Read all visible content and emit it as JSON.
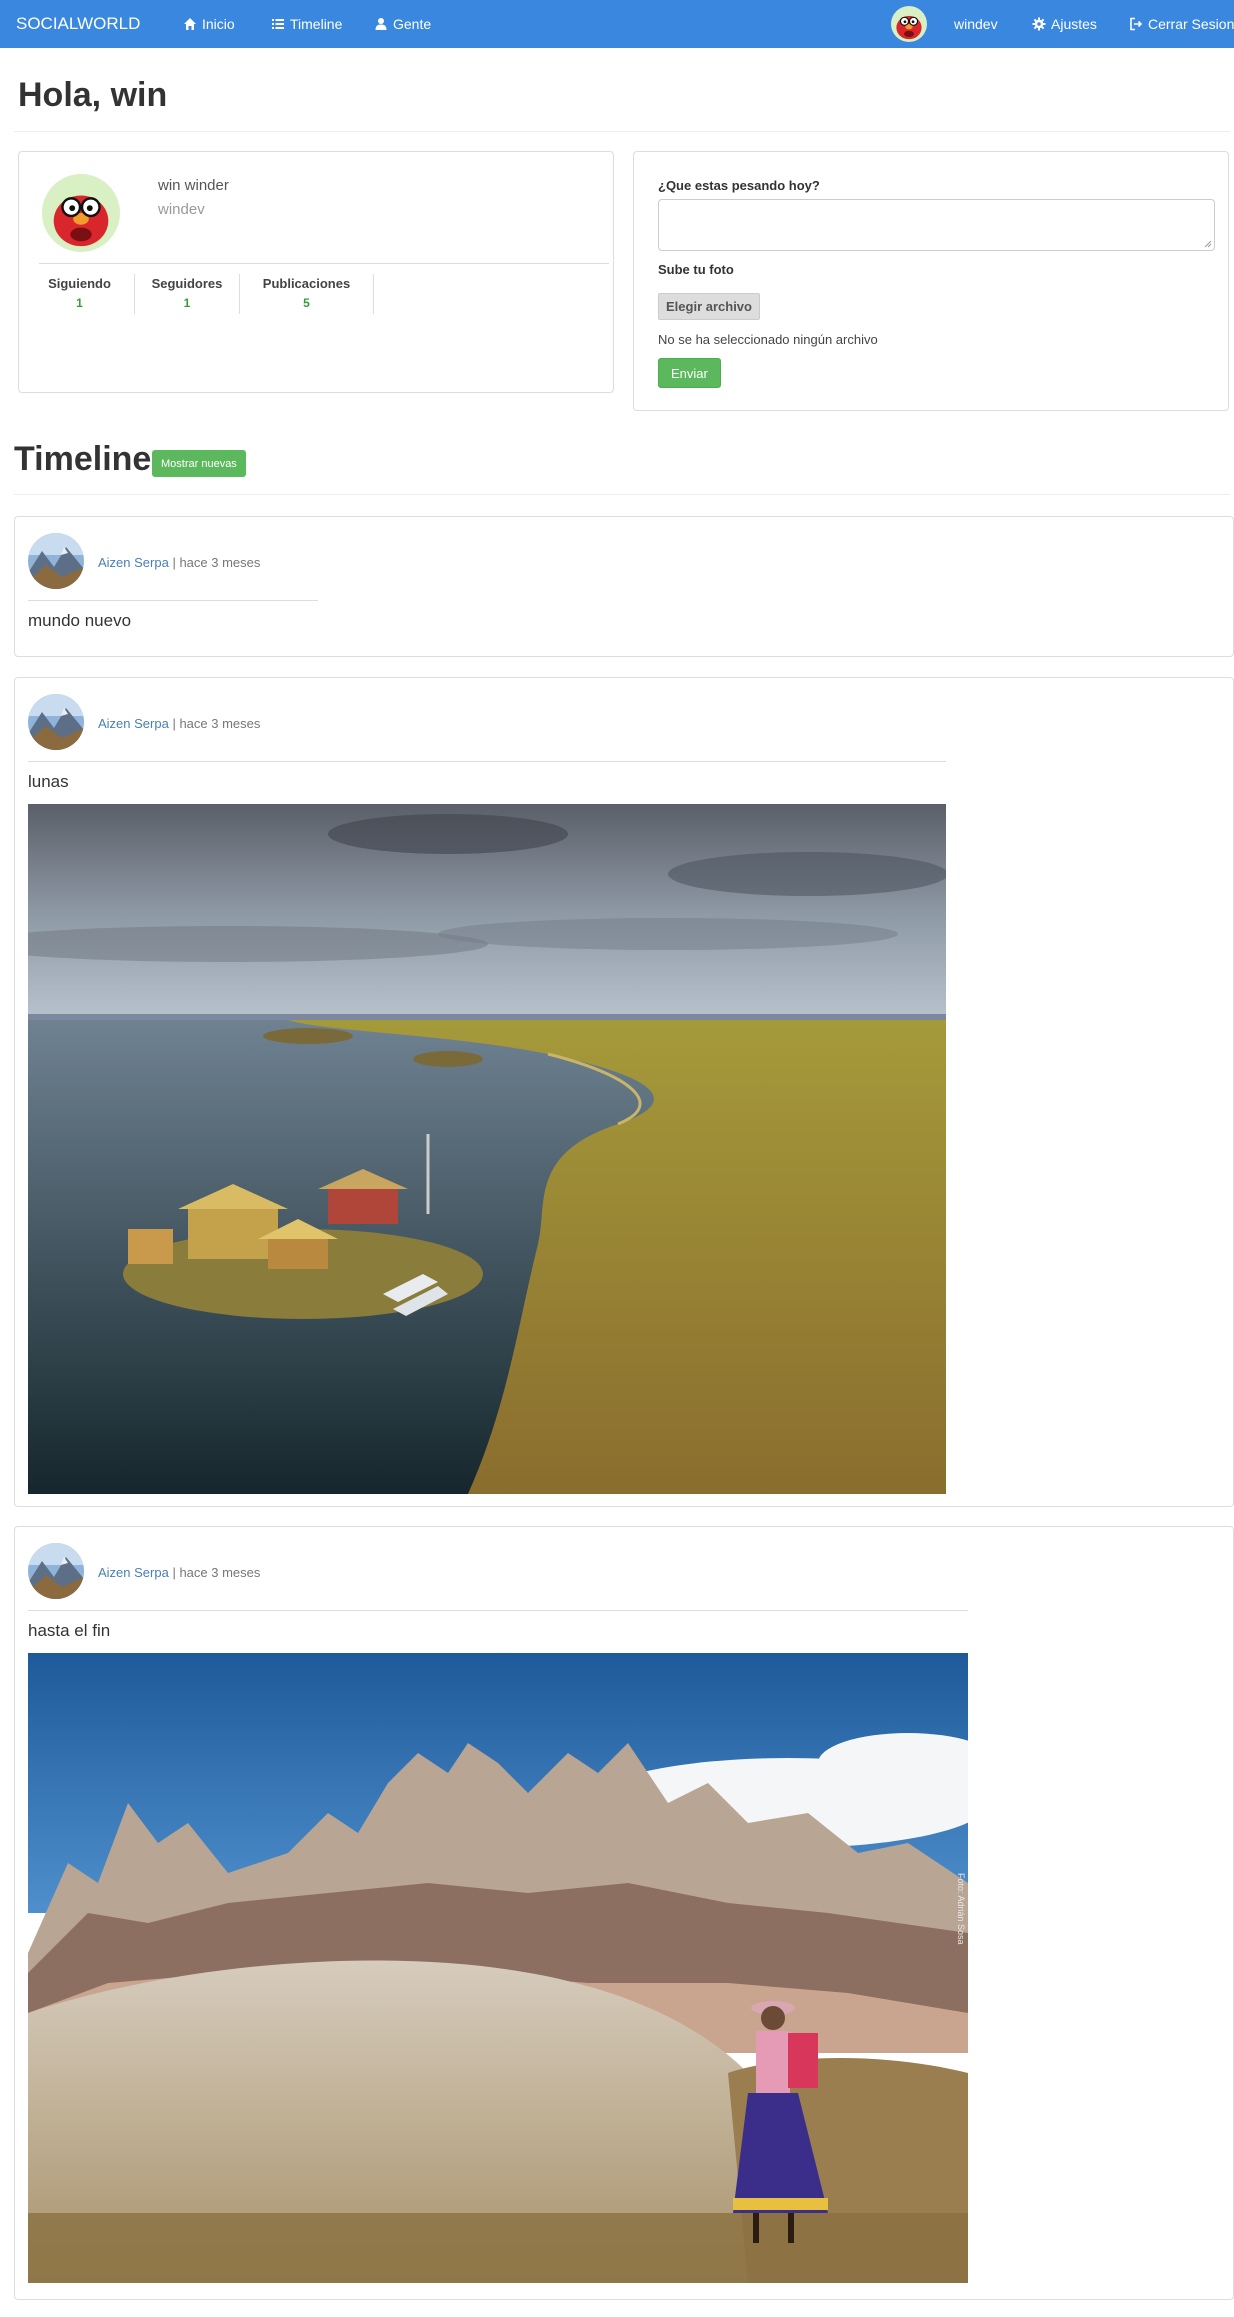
{
  "colors": {
    "navbar": "#3a87e0",
    "accent_green": "#5cb85c",
    "link": "#4a7fb5"
  },
  "navbar": {
    "brand": "SOCIALWORLD",
    "items": [
      {
        "label": "Inicio",
        "icon": "home-icon"
      },
      {
        "label": "Timeline",
        "icon": "list-icon"
      },
      {
        "label": "Gente",
        "icon": "user-icon"
      }
    ],
    "username": "windev",
    "settings": {
      "label": "Ajustes",
      "icon": "gear-icon"
    },
    "logout": {
      "label": "Cerrar Sesion",
      "icon": "logout-icon"
    }
  },
  "greeting": "Hola, win",
  "profile": {
    "name": "win winder",
    "nick": "windev",
    "stats": [
      {
        "label": "Siguiendo",
        "value": "1"
      },
      {
        "label": "Seguidores",
        "value": "1"
      },
      {
        "label": "Publicaciones",
        "value": "5"
      }
    ]
  },
  "composer": {
    "prompt_label": "¿Que estas pesando hoy?",
    "photo_label": "Sube tu foto",
    "choose_file": "Elegir archivo",
    "no_file": "No se ha seleccionado ningún archivo",
    "submit": "Enviar"
  },
  "timeline": {
    "title": "Timeline",
    "show_new": "Mostrar nuevas",
    "posts": [
      {
        "author": "Aizen Serpa",
        "separator": " | ",
        "time": "hace 3 meses",
        "text": "mundo nuevo",
        "image": null
      },
      {
        "author": "Aizen Serpa",
        "separator": " | ",
        "time": "hace 3 meses",
        "text": "lunas",
        "image": "lake-islands-photo"
      },
      {
        "author": "Aizen Serpa",
        "separator": " | ",
        "time": "hace 3 meses",
        "text": "hasta el fin",
        "image": "rock-formations-photo",
        "image_caption": "Foto: Adrián Sosa"
      }
    ]
  }
}
